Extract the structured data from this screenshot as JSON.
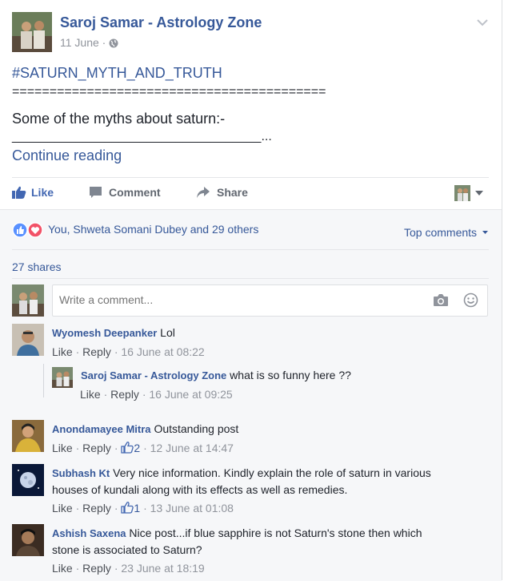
{
  "post": {
    "author": "Saroj Samar - Astrology Zone",
    "date": "11 June",
    "dot": "·",
    "hashtag": "#SATURN_MYTH_AND_TRUTH",
    "equals_line": "==========================================",
    "text1": "Some of the myths about saturn:-",
    "underline": "___________________________________...",
    "continue": "Continue reading"
  },
  "actions": {
    "like": "Like",
    "comment": "Comment",
    "share": "Share"
  },
  "reactions": {
    "summary": "You, Shweta Somani Dubey and 29 others",
    "sort": "Top comments",
    "shares": "27 shares"
  },
  "composer": {
    "placeholder": "Write a comment..."
  },
  "comments": [
    {
      "name": "Wyomesh Deepanker",
      "text": "Lol",
      "like": "Like",
      "reply": "Reply",
      "time": "· 16 June at 08:22"
    },
    {
      "name": "Saroj Samar - Astrology Zone",
      "text": "what is so funny here ??",
      "like": "Like",
      "reply": "Reply",
      "time": "· 16 June at 09:25"
    },
    {
      "name": "Anondamayee Mitra",
      "text": "Outstanding post",
      "like": "Like",
      "reply": "Reply",
      "count": "2",
      "time": "· 12 June at 14:47"
    },
    {
      "name": "Subhash Kt",
      "text": "Very nice information. Kindly explain the role of saturn in various",
      "text2": "houses of kundali along with its effects as well as remedies.",
      "like": "Like",
      "reply": "Reply",
      "count": "1",
      "time": "· 13 June at 01:08"
    },
    {
      "name": "Ashish Saxena",
      "text": "Nice post...if blue sapphire is not Saturn's stone then which",
      "text2": "stone is associated to Saturn?",
      "like": "Like",
      "reply": "Reply",
      "time": "· 23 June at 18:19"
    }
  ],
  "colors": {
    "link": "#365899",
    "like_blue": "#4267b2",
    "meta_gray": "#90949c",
    "lower_bg": "#f6f7f9"
  }
}
